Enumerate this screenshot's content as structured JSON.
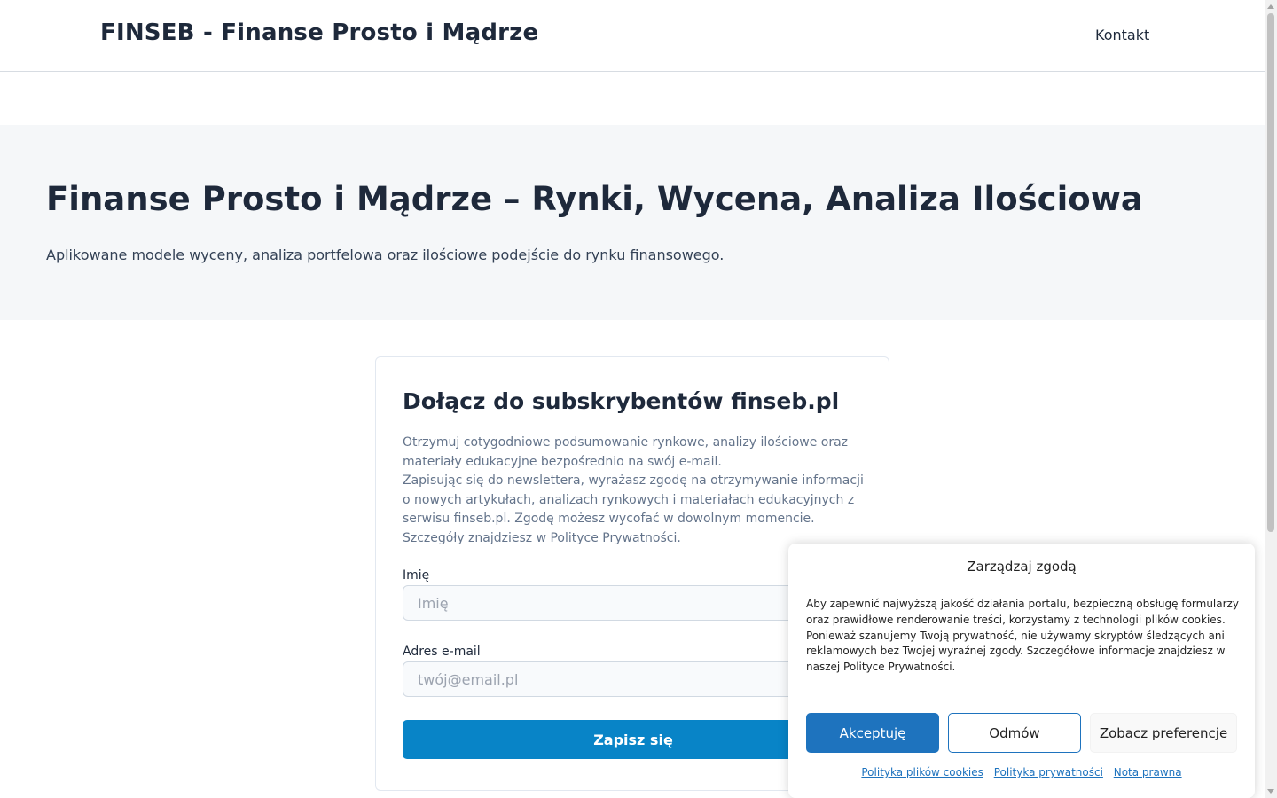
{
  "header": {
    "site_title": "FINSEB - Finanse Prosto i Mądrze",
    "nav_contact": "Kontakt"
  },
  "hero": {
    "title": "Finanse Prosto i Mądrze – Rynki, Wycena, Analiza Ilościowa",
    "subtitle": "Aplikowane modele wyceny, analiza portfelowa oraz ilościowe podejście do rynku finansowego."
  },
  "subscribe": {
    "title": "Dołącz do subskrybentów finseb.pl",
    "desc_line1": "Otrzymuj cotygodniowe podsumowanie rynkowe, analizy ilościowe oraz materiały edukacyjne bezpośrednio na swój e-mail.",
    "desc_line2": "Zapisując się do newslettera, wyrażasz zgodę na otrzymywanie informacji o nowych artykułach, analizach rynkowych i materiałach edukacyjnych z serwisu finseb.pl. Zgodę możesz wycofać w dowolnym momencie. Szczegóły znajdziesz w Polityce Prywatności.",
    "name_label": "Imię",
    "name_placeholder": "Imię",
    "email_label": "Adres e-mail",
    "email_placeholder": "twój@email.pl",
    "submit_label": "Zapisz się"
  },
  "consent": {
    "title": "Zarządzaj zgodą",
    "text": "Aby zapewnić najwyższą jakość działania portalu, bezpieczną obsługę formularzy oraz prawidłowe renderowanie treści, korzystamy z technologii plików cookies. Ponieważ szanujemy Twoją prywatność, nie używamy skryptów śledzących ani reklamowych bez Twojej wyraźnej zgody. Szczegółowe informacje znajdziesz w naszej Polityce Prywatności.",
    "accept_label": "Akceptuję",
    "deny_label": "Odmów",
    "prefs_label": "Zobacz preferencje",
    "link_cookies": "Polityka plików cookies",
    "link_privacy": "Polityka prywatności",
    "link_legal": "Nota prawna"
  },
  "colors": {
    "primary_button": "#0884c7",
    "consent_accent": "#1e73be",
    "hero_background": "#f5f7f9",
    "text_dark": "#1e293b"
  }
}
